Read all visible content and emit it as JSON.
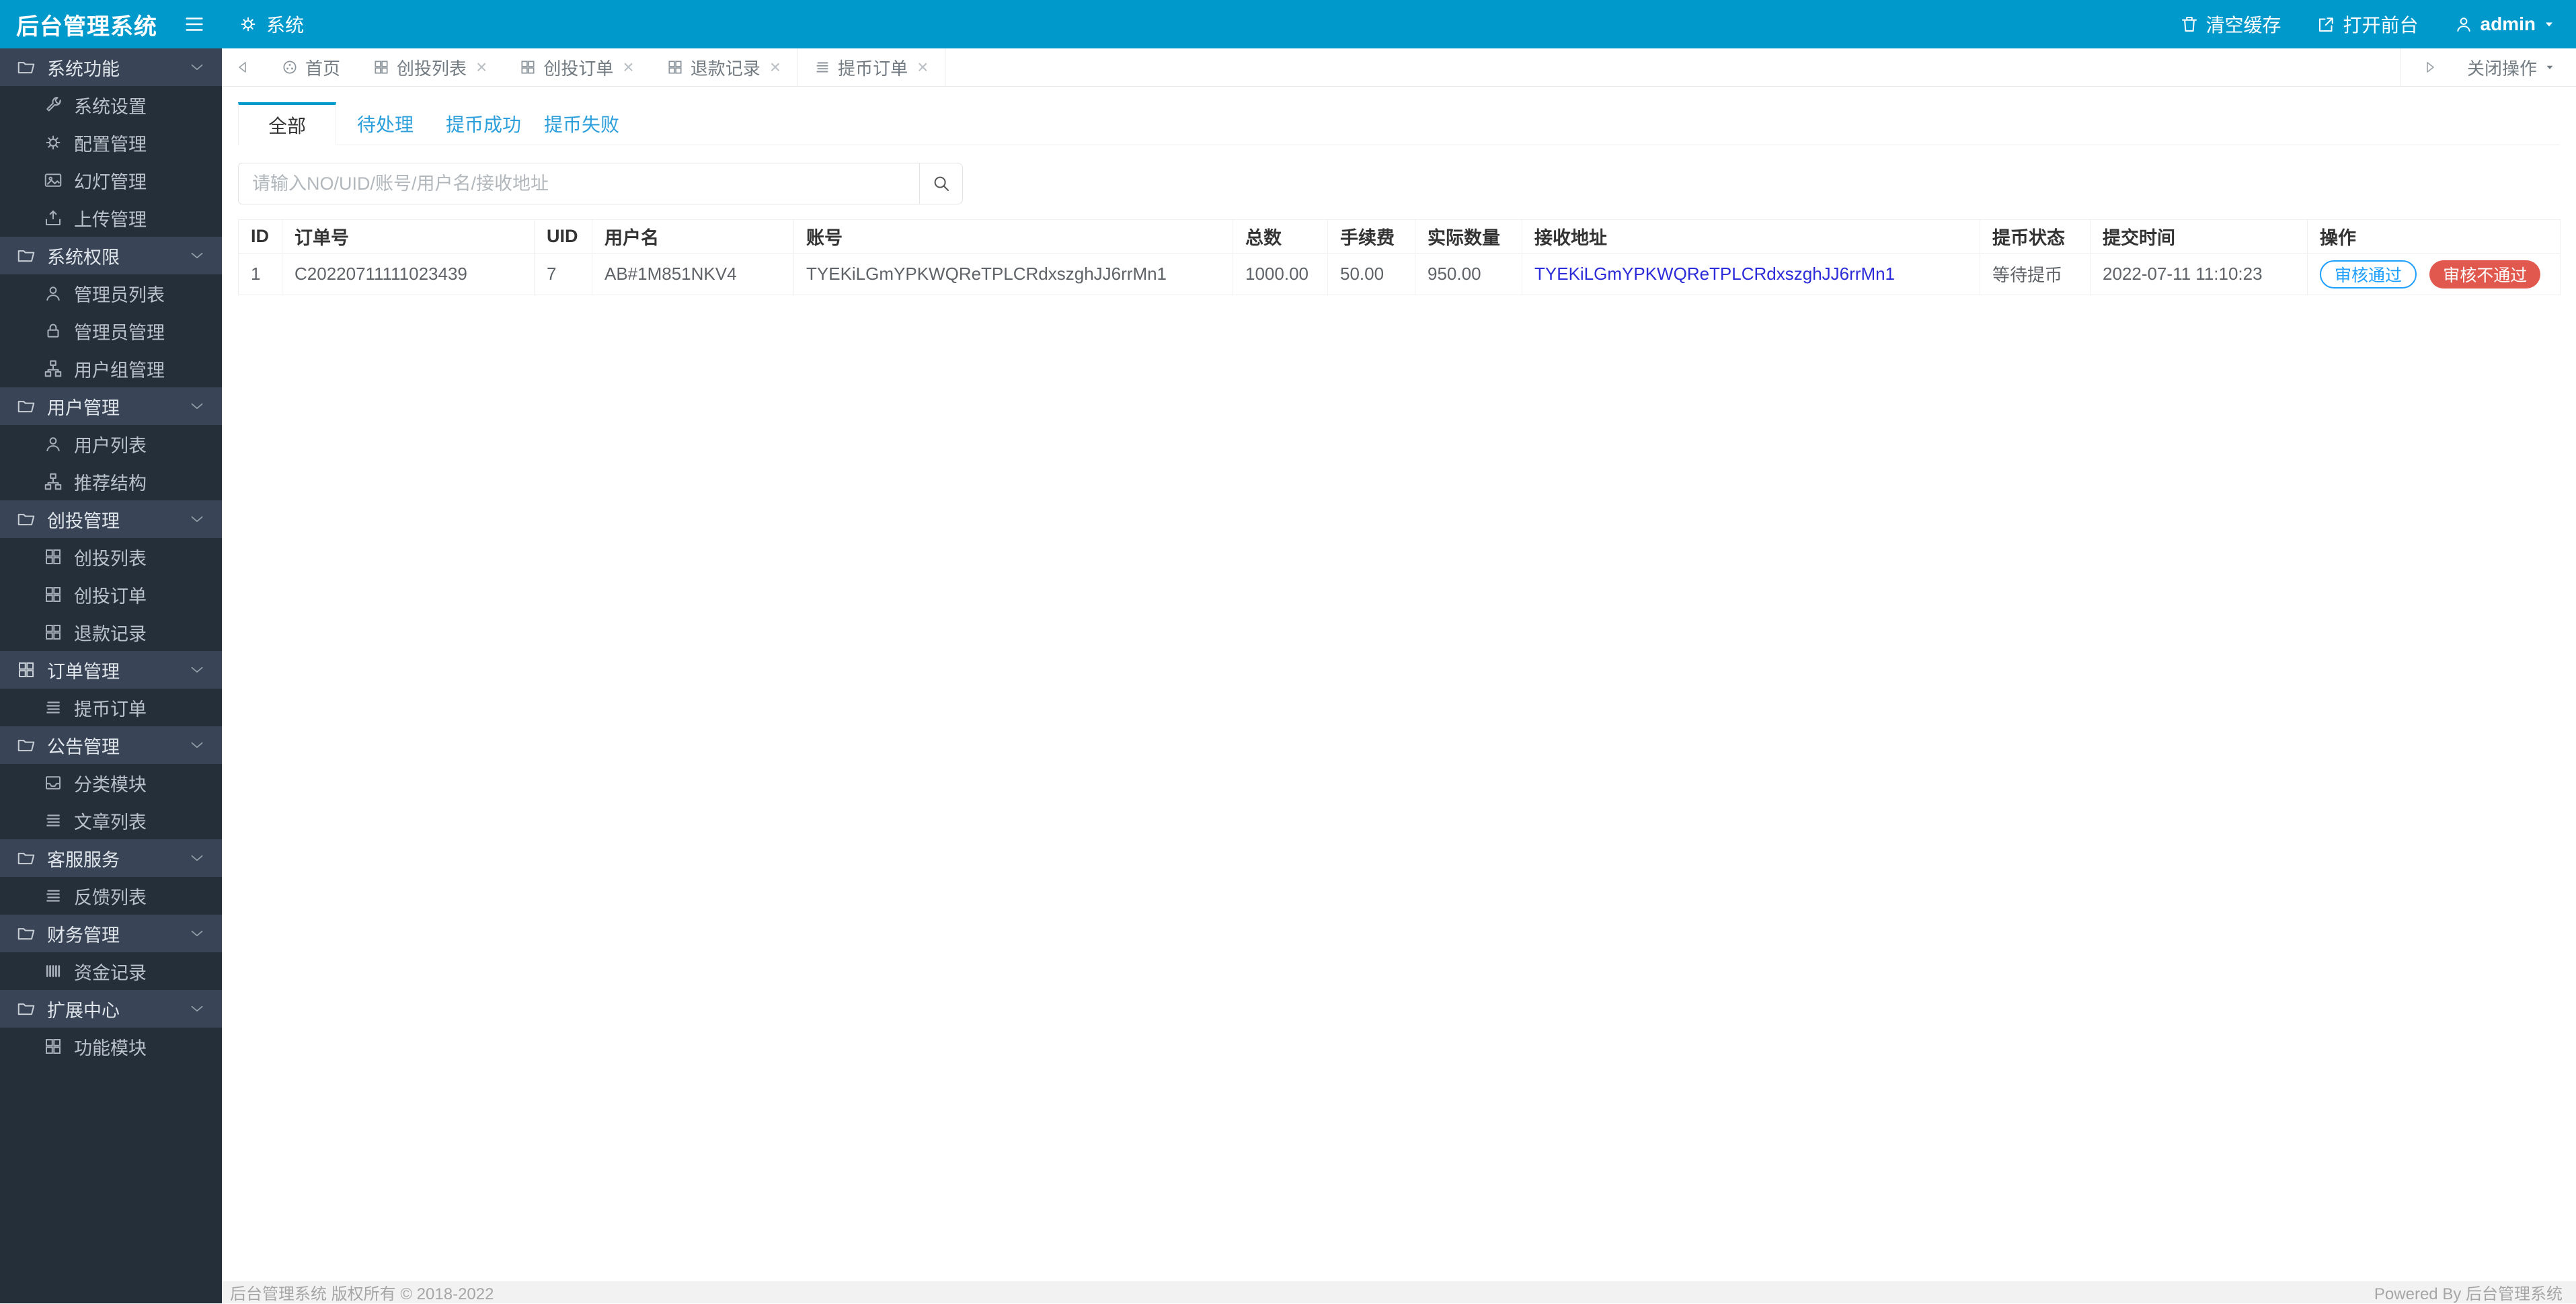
{
  "app": {
    "title": "后台管理系统"
  },
  "topbar": {
    "module": "系统",
    "clear_cache": "清空缓存",
    "open_front": "打开前台",
    "username": "admin"
  },
  "tabbar": {
    "tabs": [
      {
        "label": "首页",
        "icon": "home-icon",
        "closable": false
      },
      {
        "label": "创投列表",
        "icon": "grid-icon",
        "closable": true
      },
      {
        "label": "创投订单",
        "icon": "grid-icon",
        "closable": true
      },
      {
        "label": "退款记录",
        "icon": "grid-icon",
        "closable": true
      },
      {
        "label": "提币订单",
        "icon": "list-icon",
        "closable": true,
        "active": true
      }
    ],
    "close_char": "×",
    "close_menu": "关闭操作"
  },
  "sidebar": {
    "groups": [
      {
        "label": "系统功能",
        "icon": "folder-icon",
        "items": [
          {
            "label": "系统设置",
            "icon": "wrench-icon"
          },
          {
            "label": "配置管理",
            "icon": "gear-icon"
          },
          {
            "label": "幻灯管理",
            "icon": "image-icon"
          },
          {
            "label": "上传管理",
            "icon": "upload-icon"
          }
        ]
      },
      {
        "label": "系统权限",
        "icon": "folder-icon",
        "items": [
          {
            "label": "管理员列表",
            "icon": "user-icon"
          },
          {
            "label": "管理员管理",
            "icon": "lock-icon"
          },
          {
            "label": "用户组管理",
            "icon": "sitemap-icon"
          }
        ]
      },
      {
        "label": "用户管理",
        "icon": "folder-icon",
        "items": [
          {
            "label": "用户列表",
            "icon": "user-icon"
          },
          {
            "label": "推荐结构",
            "icon": "sitemap-icon"
          }
        ]
      },
      {
        "label": "创投管理",
        "icon": "folder-icon",
        "items": [
          {
            "label": "创投列表",
            "icon": "grid-icon"
          },
          {
            "label": "创投订单",
            "icon": "grid-icon"
          },
          {
            "label": "退款记录",
            "icon": "grid-icon"
          }
        ]
      },
      {
        "label": "订单管理",
        "icon": "grid-icon",
        "items": [
          {
            "label": "提币订单",
            "icon": "list-icon"
          }
        ]
      },
      {
        "label": "公告管理",
        "icon": "folder-icon",
        "items": [
          {
            "label": "分类模块",
            "icon": "inbox-icon"
          },
          {
            "label": "文章列表",
            "icon": "list-icon"
          }
        ]
      },
      {
        "label": "客服服务",
        "icon": "folder-icon",
        "items": [
          {
            "label": "反馈列表",
            "icon": "list-icon"
          }
        ]
      },
      {
        "label": "财务管理",
        "icon": "folder-icon",
        "items": [
          {
            "label": "资金记录",
            "icon": "barcode-icon"
          }
        ]
      },
      {
        "label": "扩展中心",
        "icon": "folder-icon",
        "items": [
          {
            "label": "功能模块",
            "icon": "grid-icon"
          }
        ]
      }
    ]
  },
  "content": {
    "subtabs": [
      {
        "label": "全部",
        "active": true
      },
      {
        "label": "待处理"
      },
      {
        "label": "提币成功"
      },
      {
        "label": "提币失败"
      }
    ],
    "search": {
      "placeholder": "请输入NO/UID/账号/用户名/接收地址"
    },
    "table": {
      "headers": [
        "ID",
        "订单号",
        "UID",
        "用户名",
        "账号",
        "总数",
        "手续费",
        "实际数量",
        "接收地址",
        "提币状态",
        "提交时间",
        "操作"
      ],
      "rows": [
        {
          "id": "1",
          "order_no": "C20220711111023439",
          "uid": "7",
          "username": "AB#1M851NKV4",
          "account": "TYEKiLGmYPKWQReTPLCRdxszghJJ6rrMn1",
          "total": "1000.00",
          "fee": "50.00",
          "actual": "950.00",
          "address": "TYEKiLGmYPKWQReTPLCRdxszghJJ6rrMn1",
          "status": "等待提币",
          "time": "2022-07-11 11:10:23",
          "approve": "审核通过",
          "reject": "审核不通过"
        }
      ]
    }
  },
  "footer": {
    "left": "后台管理系统 版权所有 © 2018-2022",
    "right": "Powered By 后台管理系统"
  },
  "colors": {
    "accent": "#0099cc",
    "sidebar_base": "#252f3a",
    "sidebar_group": "#394556",
    "danger_red": "#e60000",
    "link_blue": "#2b2bd9",
    "approve_blue": "#1e9fff",
    "reject_red": "#e0584e",
    "status_gray": "#9aa0a5"
  }
}
